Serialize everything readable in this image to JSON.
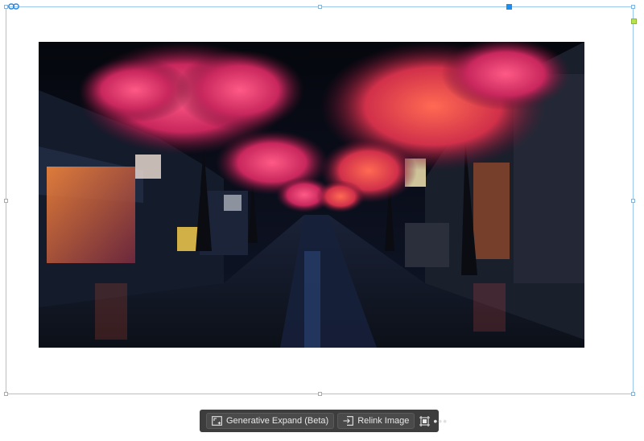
{
  "taskbar": {
    "generative_expand_label": "Generative Expand (Beta)",
    "relink_label": "Relink Image",
    "more_label": "•••"
  },
  "icons": {
    "link": "link-icon",
    "generative_expand": "generative-expand-icon",
    "relink": "relink-icon",
    "crop": "crop-icon",
    "more": "more-icon"
  },
  "colors": {
    "selection": "#9ac7ee",
    "handle_active": "#1b8ef0",
    "taskbar_bg": "#3d3d3d"
  }
}
